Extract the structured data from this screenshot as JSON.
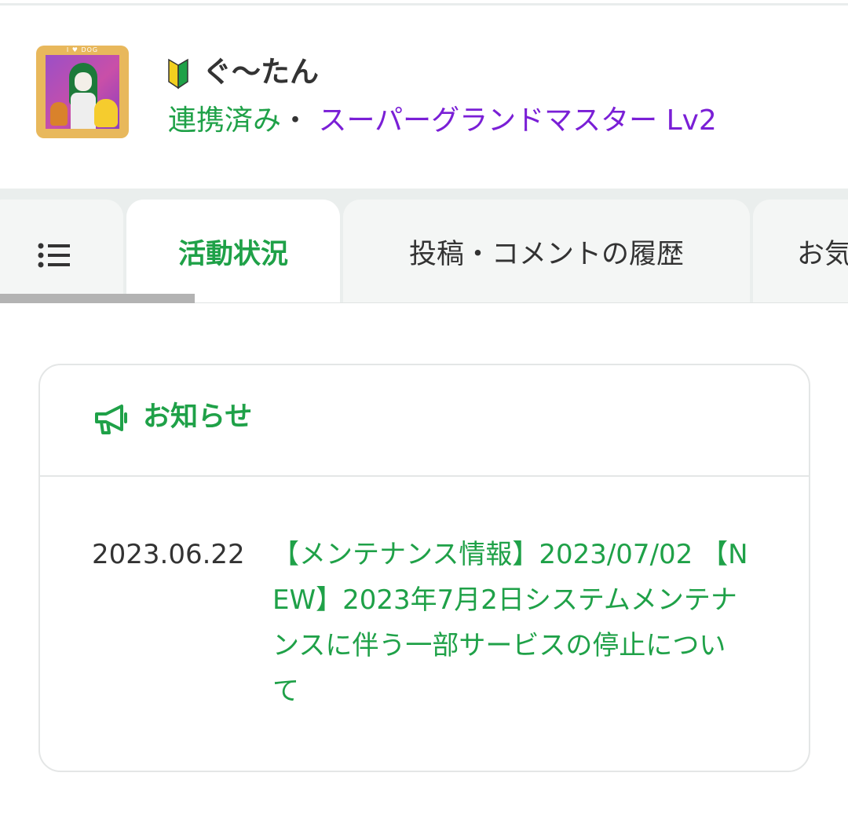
{
  "profile": {
    "avatar_caption": "I ♥ DOG",
    "username": "ぐ〜たん",
    "status_linked": "連携済み",
    "separator": "・",
    "rank": "スーパーグランドマスター Lv2",
    "icon": "beginner-mark-icon"
  },
  "tabs": [
    {
      "label": "",
      "icon": "list-icon"
    },
    {
      "label": "活動状況",
      "active": true
    },
    {
      "label": "投稿・コメントの履歴"
    },
    {
      "label": "お気"
    }
  ],
  "tab_scroll_progress": 0.23,
  "notice": {
    "title": "お知らせ",
    "icon": "megaphone-icon",
    "items": [
      {
        "date": "2023.06.22",
        "text": "【メンテナンス情報】2023/07/02 【NEW】2023年7月2日システムメンテナンスに伴う一部サービスの停止について"
      }
    ]
  },
  "colors": {
    "accent_green": "#1fa148",
    "rank_purple": "#7a1fd6",
    "tab_bg": "#f4f6f5",
    "tab_bar_bg": "#eaeeed"
  }
}
